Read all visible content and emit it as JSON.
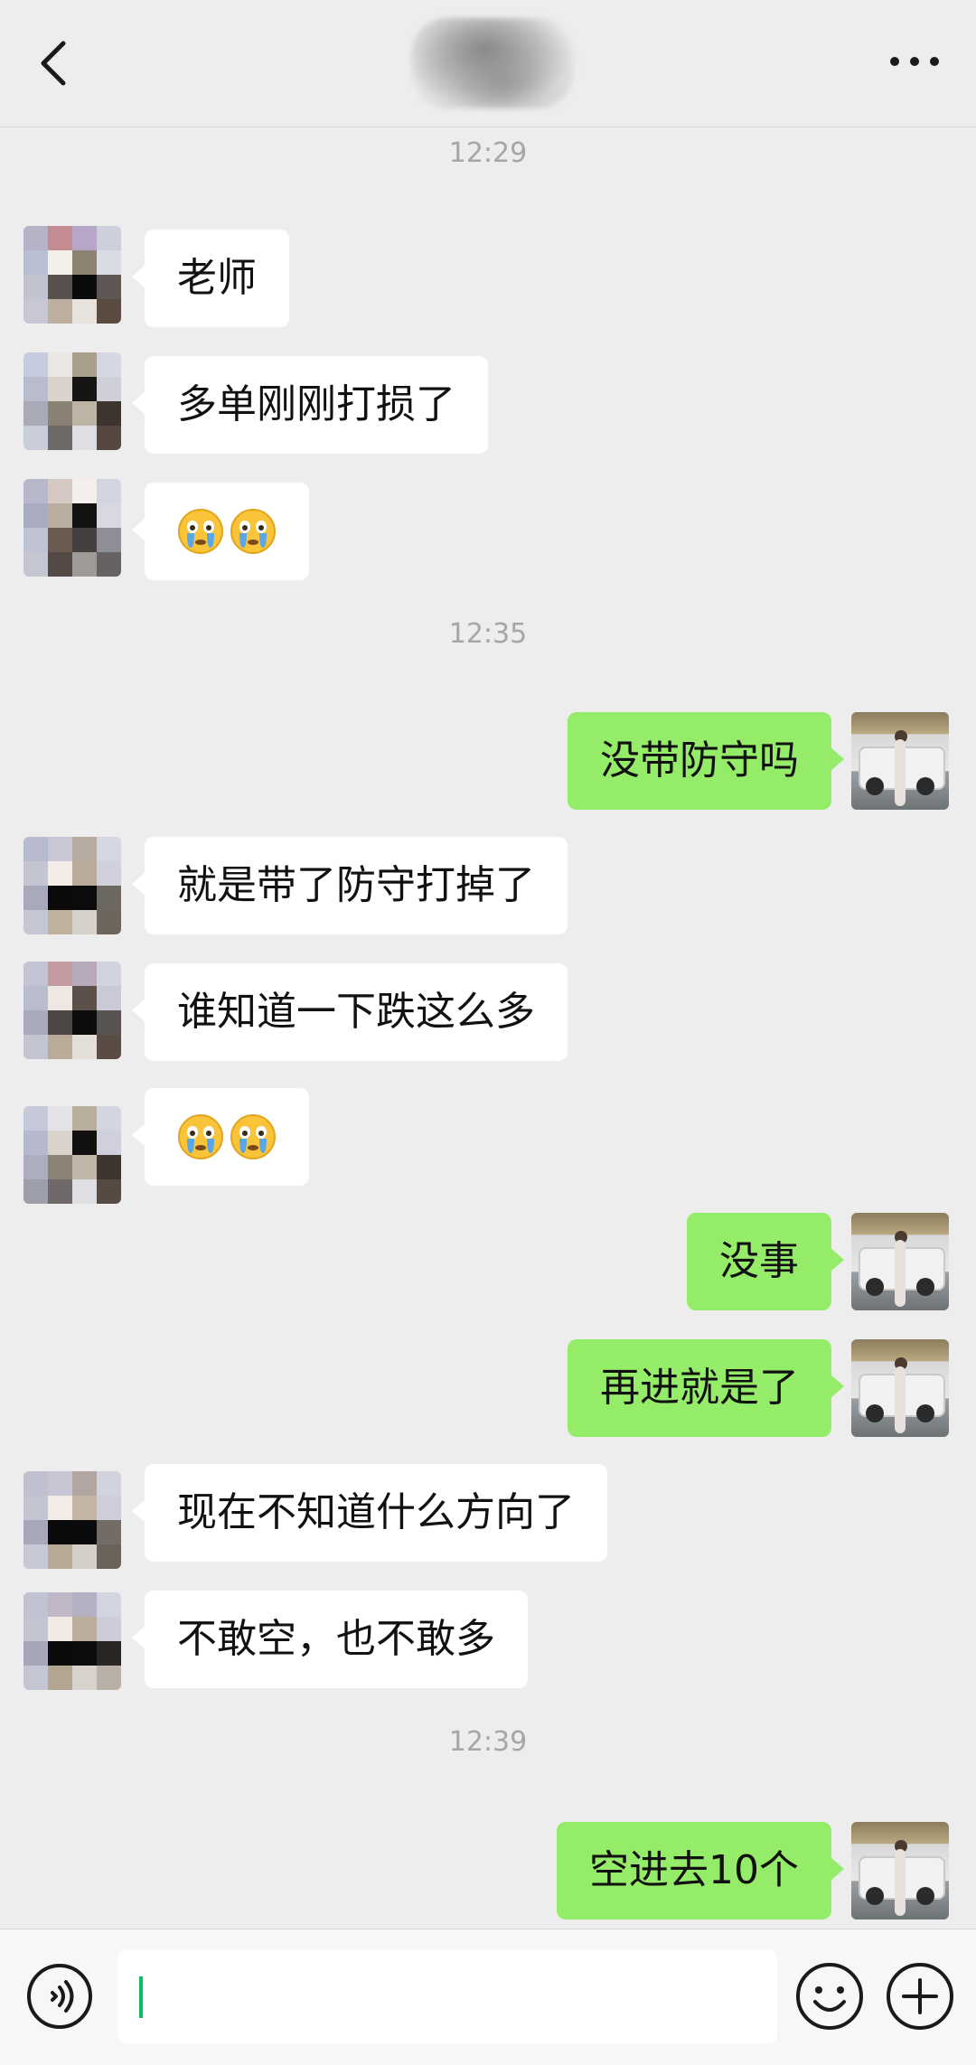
{
  "colors": {
    "outgoing_bubble": "#95ec69",
    "incoming_bubble": "#ffffff",
    "background": "#ededed"
  },
  "header": {
    "back_icon": "chevron-left-icon",
    "more_icon": "more-horizontal-icon"
  },
  "messages": [
    {
      "type": "time",
      "text": "12:29"
    },
    {
      "type": "in",
      "text": "老师"
    },
    {
      "type": "in",
      "text": "多单刚刚打损了"
    },
    {
      "type": "in",
      "emoji": "crying-face-icon x2"
    },
    {
      "type": "time",
      "text": "12:35"
    },
    {
      "type": "out",
      "text": "没带防守吗"
    },
    {
      "type": "in",
      "text": "就是带了防守打掉了"
    },
    {
      "type": "in",
      "text": "谁知道一下跌这么多"
    },
    {
      "type": "in",
      "emoji": "crying-face-icon x2"
    },
    {
      "type": "out",
      "text": "没事"
    },
    {
      "type": "out",
      "text": "再进就是了"
    },
    {
      "type": "in",
      "text": "现在不知道什么方向了"
    },
    {
      "type": "in",
      "text": "不敢空，也不敢多"
    },
    {
      "type": "time",
      "text": "12:39"
    },
    {
      "type": "out",
      "text": "空进去10个"
    }
  ],
  "input_bar": {
    "voice_icon": "voice-icon",
    "message_value": "",
    "emoji_icon": "smiley-icon",
    "plus_icon": "plus-circle-icon"
  }
}
